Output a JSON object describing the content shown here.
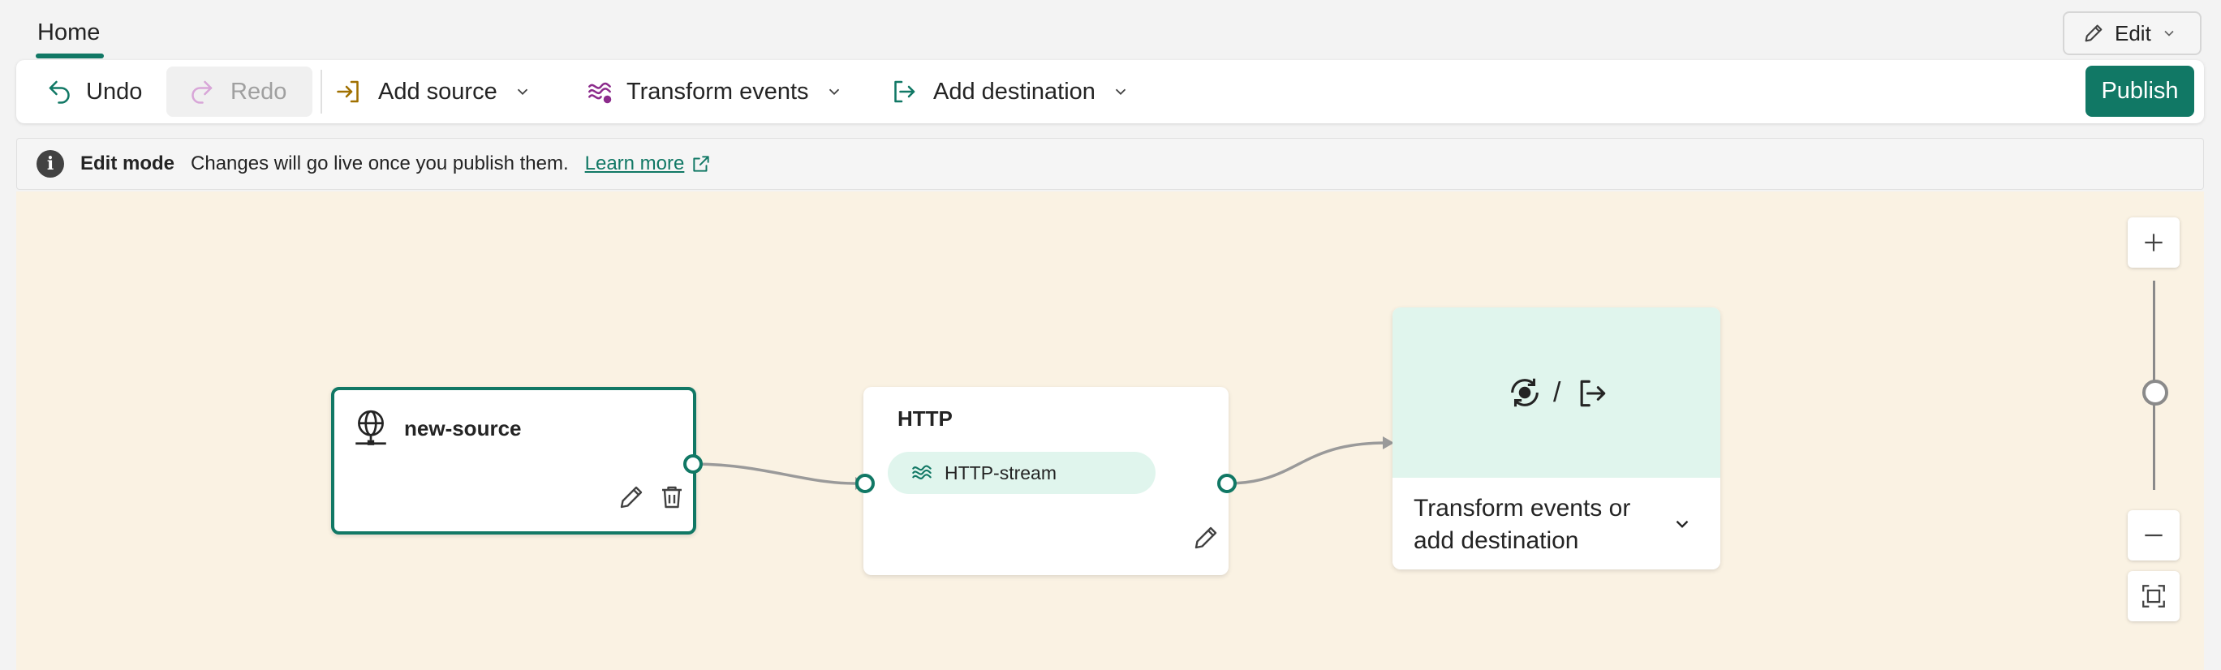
{
  "header": {
    "tab_home": "Home",
    "edit_label": "Edit"
  },
  "toolbar": {
    "undo": "Undo",
    "redo": "Redo",
    "add_source": "Add source",
    "transform_events": "Transform events",
    "add_destination": "Add destination",
    "publish": "Publish"
  },
  "infobar": {
    "mode": "Edit mode",
    "message": "Changes will go live once you publish them.",
    "link": "Learn more"
  },
  "canvas": {
    "source_node": {
      "title": "new-source"
    },
    "stream_node": {
      "title": "HTTP",
      "stream_label": "HTTP-stream"
    },
    "dest_node": {
      "separator": "/",
      "label": "Transform events or add destination"
    }
  },
  "colors": {
    "accent": "#117865",
    "canvas_bg": "#faf2e3",
    "dest_tint": "#e0f5ed",
    "transform_icon": "#8c2c8c",
    "source_icon": "#a07000"
  },
  "icons": {
    "undo": "undo-icon",
    "redo": "redo-icon",
    "add_source": "sign-in-arrow-icon",
    "transform": "stream-waves-icon",
    "destination": "sign-out-arrow-icon",
    "edit": "pencil-icon",
    "info": "info-icon",
    "external": "open-external-icon",
    "source": "globe-network-icon",
    "delete": "trash-icon",
    "zoom_in": "plus-icon",
    "zoom_out": "minus-icon",
    "fit": "fit-to-screen-icon"
  }
}
